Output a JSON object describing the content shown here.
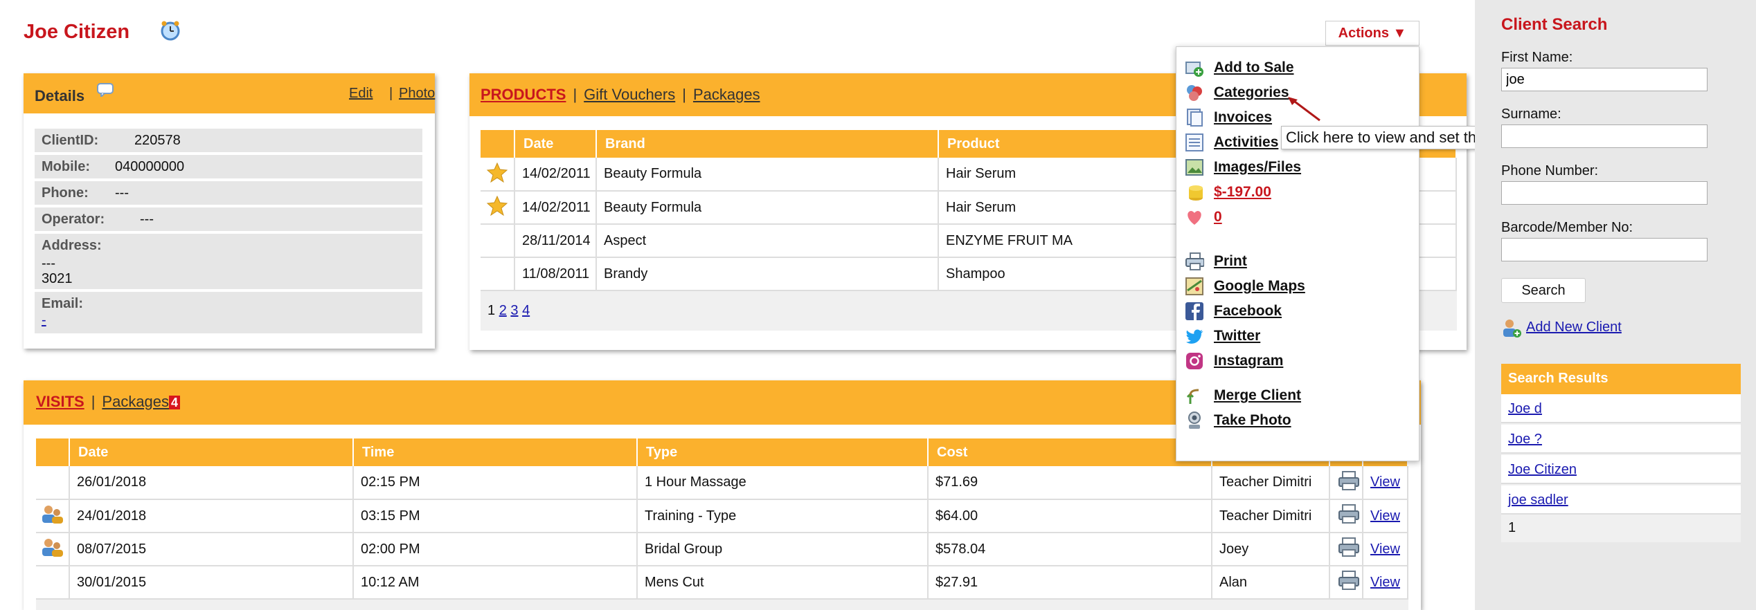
{
  "header": {
    "client_name": "Joe Citizen"
  },
  "details": {
    "title": "Details",
    "edit": "Edit",
    "photo": "Photo",
    "sep": "|",
    "client_id_label": "ClientID:",
    "client_id": "220578",
    "mobile_label": "Mobile:",
    "mobile": "040000000",
    "phone_label": "Phone:",
    "phone": "---",
    "operator_label": "Operator:",
    "operator": "---",
    "address_label": "Address:",
    "address_line1": "---",
    "address_line2": "3021",
    "email_label": "Email:",
    "email": "-"
  },
  "products": {
    "tabs": [
      "PRODUCTS",
      "Gift Vouchers",
      "Packages"
    ],
    "sep": "|",
    "columns": [
      "Date",
      "Brand",
      "Product"
    ],
    "rows": [
      {
        "date": "14/02/2011",
        "brand": "Beauty Formula",
        "product": "Hair Serum"
      },
      {
        "date": "14/02/2011",
        "brand": "Beauty Formula",
        "product": "Hair Serum"
      },
      {
        "date": "28/11/2014",
        "brand": "Aspect",
        "product": "ENZYME FRUIT MA"
      },
      {
        "date": "11/08/2011",
        "brand": "Brandy",
        "product": "Shampoo"
      }
    ],
    "pages": [
      "1",
      "2",
      "3",
      "4"
    ]
  },
  "visits": {
    "tabs": [
      "VISITS",
      "Packages"
    ],
    "sep": "|",
    "badge": "4",
    "columns": [
      "Date",
      "Time",
      "Type",
      "Cost"
    ],
    "rows": [
      {
        "date": "26/01/2018",
        "time": "02:15 PM",
        "type": "1 Hour Massage",
        "cost": "$71.69",
        "staff": "Teacher Dimitri",
        "view": "View"
      },
      {
        "date": "24/01/2018",
        "time": "03:15 PM",
        "type": "Training - Type",
        "cost": "$64.00",
        "staff": "Teacher Dimitri",
        "view": "View"
      },
      {
        "date": "08/07/2015",
        "time": "02:00 PM",
        "type": "Bridal Group",
        "cost": "$578.04",
        "staff": "Joey",
        "view": "View"
      },
      {
        "date": "30/01/2015",
        "time": "10:12 AM",
        "type": "Mens Cut",
        "cost": "$27.91",
        "staff": "Alan",
        "view": "View"
      }
    ]
  },
  "actions": {
    "button": "Actions ▼",
    "items": [
      "Add to Sale",
      "Categories",
      "Invoices",
      "Activities",
      "Images/Files",
      "$-197.00",
      "0",
      "Print",
      "Google Maps",
      "Facebook",
      "Twitter",
      "Instagram",
      "Merge Client",
      "Take Photo"
    ],
    "tooltip": "Click here to view and set the client's categories"
  },
  "search": {
    "title": "Client Search",
    "first_name_label": "First Name:",
    "first_name_value": "joe",
    "surname_label": "Surname:",
    "surname_value": "",
    "phone_label": "Phone Number:",
    "phone_value": "",
    "barcode_label": "Barcode/Member No:",
    "barcode_value": "",
    "button": "Search",
    "add_new": "Add New Client",
    "results_title": "Search Results",
    "results": [
      "Joe d",
      "Joe ?",
      "Joe Citizen",
      "joe sadler"
    ],
    "page": "1"
  },
  "colors": {
    "accent": "#fbb12d",
    "brand_red": "#c8161d",
    "link": "#1a1ab0"
  }
}
